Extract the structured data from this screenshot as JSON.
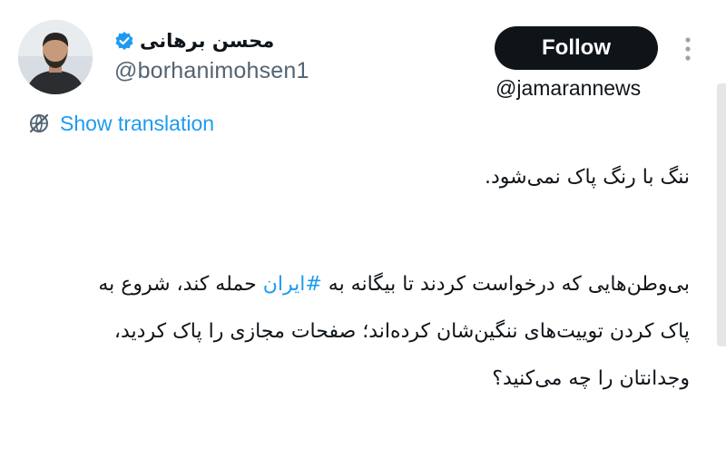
{
  "author": {
    "display_name": "محسن برهانی",
    "handle": "@borhanimohsen1",
    "verified": true
  },
  "actions": {
    "follow_label": "Follow"
  },
  "watermark": "@jamarannews",
  "translation": {
    "label": "Show translation"
  },
  "tweet": {
    "line1": "ننگ با رنگ پاک نمی‌شود.",
    "para2_before": "بی‌وطن‌هایی که درخواست کردند تا بیگانه به ",
    "hashtag": "#ایران",
    "para2_after": " حمله کند، شروع به پاک کردن توییت‌های ننگین‌شان کرده‌اند؛ صفحات مجازی را پاک کردید، وجدانتان را چه می‌کنید؟"
  },
  "colors": {
    "link_blue": "#1d9bf0",
    "follow_bg": "#0f1419",
    "secondary_text": "#536471"
  },
  "icons": {
    "verified": "verified-badge-icon",
    "more": "more-vertical-icon",
    "translation": "globe-slash-icon"
  }
}
